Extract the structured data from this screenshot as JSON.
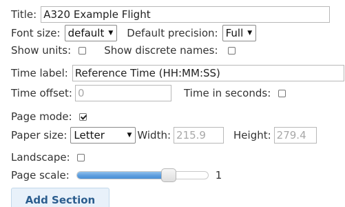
{
  "title": {
    "label": "Title:",
    "value": "A320 Example Flight"
  },
  "font_size": {
    "label": "Font size:",
    "selected": "default"
  },
  "default_precision": {
    "label": "Default precision:",
    "selected": "Full"
  },
  "show_units": {
    "label": "Show units:",
    "checked": false
  },
  "show_discrete_names": {
    "label": "Show discrete names:",
    "checked": false
  },
  "time_label": {
    "label": "Time label:",
    "value": "Reference Time (HH:MM:SS)"
  },
  "time_offset": {
    "label": "Time offset:",
    "value": "0"
  },
  "time_in_seconds": {
    "label": "Time in seconds:",
    "checked": false
  },
  "page_mode": {
    "label": "Page mode:",
    "checked": true
  },
  "paper_size": {
    "label": "Paper size:",
    "selected": "Letter"
  },
  "width": {
    "label": "Width:",
    "value": "215.9"
  },
  "height": {
    "label": "Height:",
    "value": "279.4"
  },
  "landscape": {
    "label": "Landscape:",
    "checked": false
  },
  "page_scale": {
    "label": "Page scale:",
    "value": "1",
    "fraction": 0.72
  },
  "add_section": {
    "label": "Add Section"
  },
  "colors": {
    "accent": "#5a9bdc",
    "button_text": "#2b5d8e",
    "button_bg": "#e8f1fa"
  }
}
